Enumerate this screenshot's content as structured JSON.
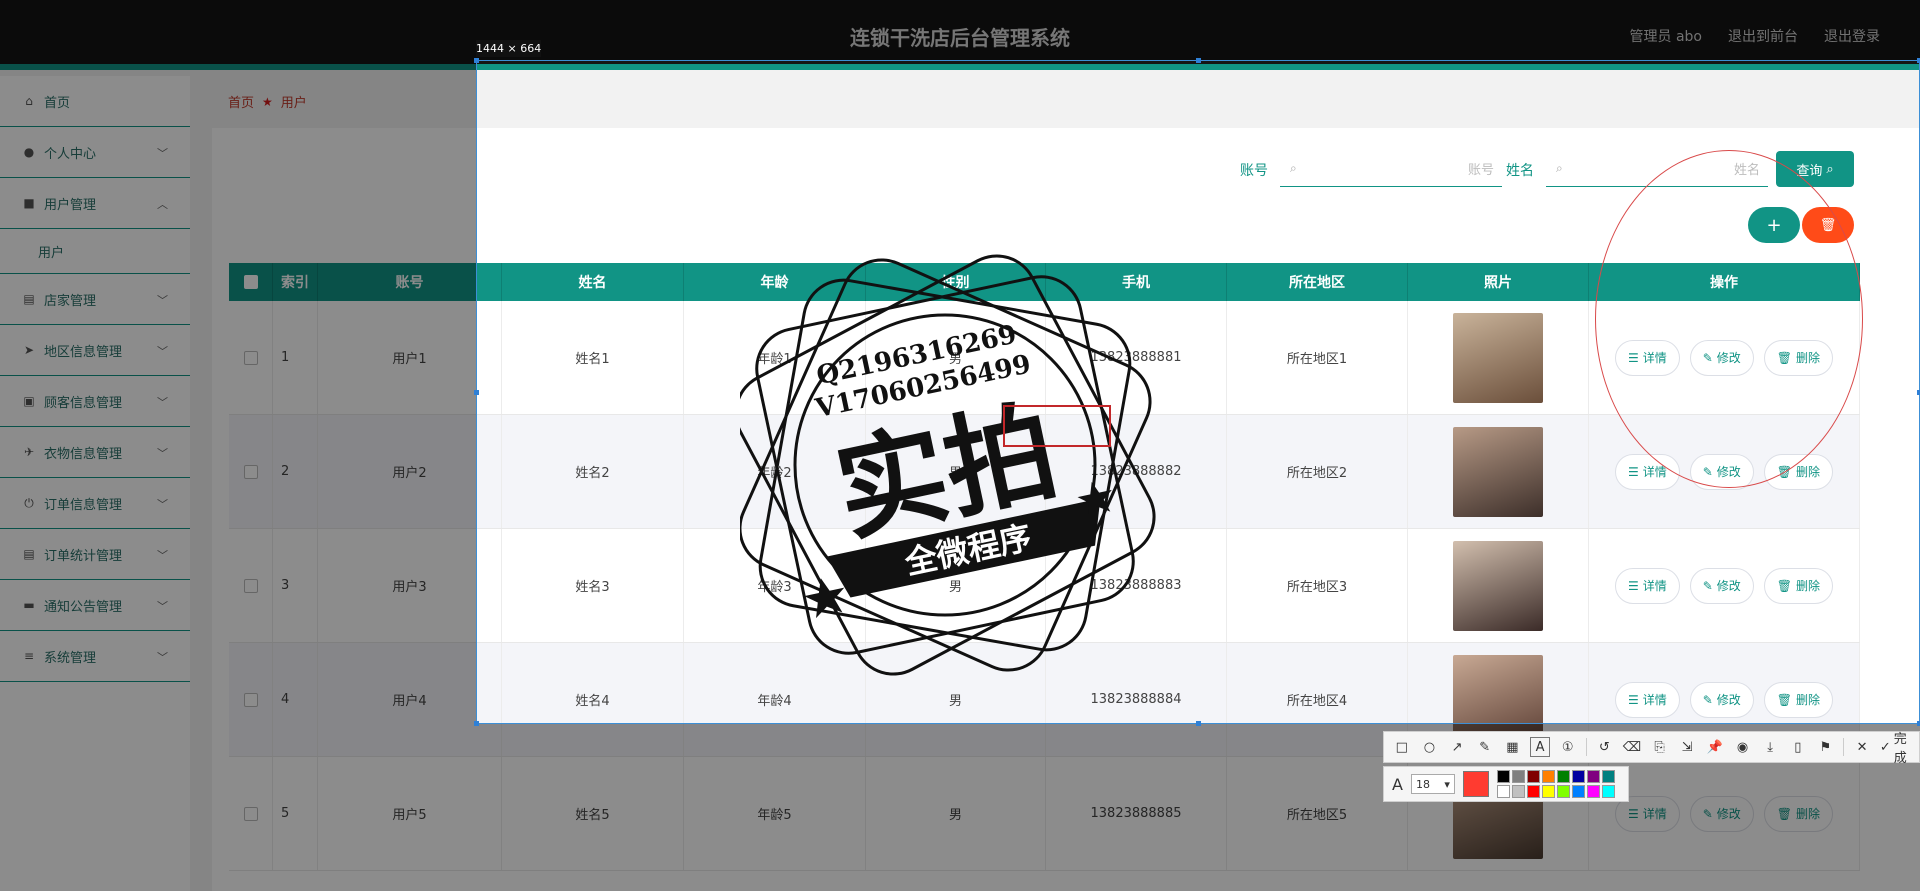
{
  "header": {
    "title": "连锁干洗店后台管理系统",
    "user": "管理员 abo",
    "to_front": "退出到前台",
    "logout": "退出登录"
  },
  "sidebar": {
    "items": [
      {
        "label": "首页",
        "icon": "home-icon",
        "chevron": ""
      },
      {
        "label": "个人中心",
        "icon": "user-icon",
        "chevron": "﹀"
      },
      {
        "label": "用户管理",
        "icon": "briefcase-icon",
        "chevron": "︿"
      },
      {
        "label": "用户",
        "sub": true
      },
      {
        "label": "店家管理",
        "icon": "clipboard-icon",
        "chevron": "﹀"
      },
      {
        "label": "地区信息管理",
        "icon": "send-icon",
        "chevron": "﹀"
      },
      {
        "label": "顾客信息管理",
        "icon": "picture-icon",
        "chevron": "﹀"
      },
      {
        "label": "衣物信息管理",
        "icon": "paper-plane-icon",
        "chevron": "﹀"
      },
      {
        "label": "订单信息管理",
        "icon": "power-icon",
        "chevron": "﹀"
      },
      {
        "label": "订单统计管理",
        "icon": "clipboard-icon",
        "chevron": "﹀"
      },
      {
        "label": "通知公告管理",
        "icon": "ticket-icon",
        "chevron": "﹀"
      },
      {
        "label": "系统管理",
        "icon": "list-icon",
        "chevron": "﹀"
      }
    ]
  },
  "breadcrumb": {
    "home": "首页",
    "current": "用户"
  },
  "search": {
    "account_label": "账号",
    "account_placeholder": "账号",
    "name_label": "姓名",
    "name_placeholder": "姓名",
    "query_button": "查询"
  },
  "actions": {
    "add": "+",
    "delete": "🗑"
  },
  "table": {
    "columns": [
      "索引",
      "账号",
      "姓名",
      "年龄",
      "性别",
      "手机",
      "所在地区",
      "照片",
      "操作"
    ],
    "rows": [
      {
        "index": "1",
        "account": "用户1",
        "name": "姓名1",
        "age": "年龄1",
        "gender": "男",
        "phone": "13823888881",
        "region": "所在地区1"
      },
      {
        "index": "2",
        "account": "用户2",
        "name": "姓名2",
        "age": "年龄2",
        "gender": "男",
        "phone": "13823888882",
        "region": "所在地区2"
      },
      {
        "index": "3",
        "account": "用户3",
        "name": "姓名3",
        "age": "年龄3",
        "gender": "男",
        "phone": "13823888883",
        "region": "所在地区3"
      },
      {
        "index": "4",
        "account": "用户4",
        "name": "姓名4",
        "age": "年龄4",
        "gender": "男",
        "phone": "13823888884",
        "region": "所在地区4"
      },
      {
        "index": "5",
        "account": "用户5",
        "name": "姓名5",
        "age": "年龄5",
        "gender": "男",
        "phone": "13823888885",
        "region": "所在地区5"
      }
    ],
    "row_actions": {
      "detail": "详情",
      "edit": "修改",
      "delete": "删除"
    }
  },
  "capture": {
    "size_label": "1444 × 664",
    "done_label": "完成",
    "font_size": "18",
    "current_color": "#ff3b30",
    "swatches": [
      "#000000",
      "#808080",
      "#800000",
      "#ff8000",
      "#008000",
      "#0000a0",
      "#800080",
      "#008080",
      "#ffffff",
      "#c0c0c0",
      "#ff0000",
      "#ffff00",
      "#80ff00",
      "#0080ff",
      "#ff00ff",
      "#00ffff"
    ]
  },
  "stamp": {
    "line1": "Q2196316269",
    "line2": "V17060256499",
    "big": "实拍",
    "banner": "全微程序"
  }
}
